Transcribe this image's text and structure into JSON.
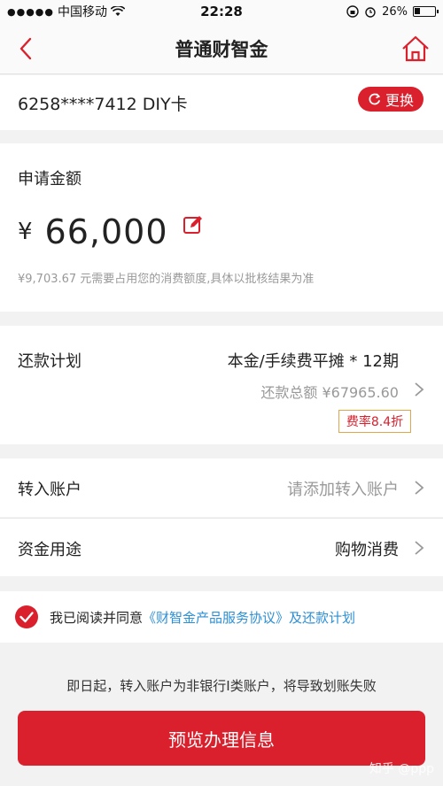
{
  "status_bar": {
    "carrier": "中国移动",
    "time": "22:28",
    "battery": "26%"
  },
  "nav": {
    "title": "普通财智金"
  },
  "card": {
    "number": "6258****7412 DIY卡",
    "change_label": "更换"
  },
  "amount": {
    "label": "申请金额",
    "currency": "¥",
    "value": "66,000",
    "note": "¥9,703.67 元需要占用您的消费额度,具体以批核结果为准"
  },
  "plan": {
    "label": "还款计划",
    "value": "本金/手续费平摊 * 12期",
    "total": "还款总额 ¥67965.60",
    "rate_badge": "费率8.4折"
  },
  "transfer": {
    "label": "转入账户",
    "placeholder": "请添加转入账户"
  },
  "purpose": {
    "label": "资金用途",
    "value": "购物消费"
  },
  "agreement": {
    "prefix": "我已阅读并同意",
    "link": "《财智金产品服务协议》及还款计划",
    "checked": true
  },
  "warning": "即日起，转入账户为非银行I类账户，将导致划账失败",
  "preview_button": "预览办理信息",
  "watermark": "知乎 @ppp",
  "colors": {
    "brand_red": "#d9202c",
    "link_blue": "#2c8fd6",
    "badge_border": "#e0a64a"
  }
}
